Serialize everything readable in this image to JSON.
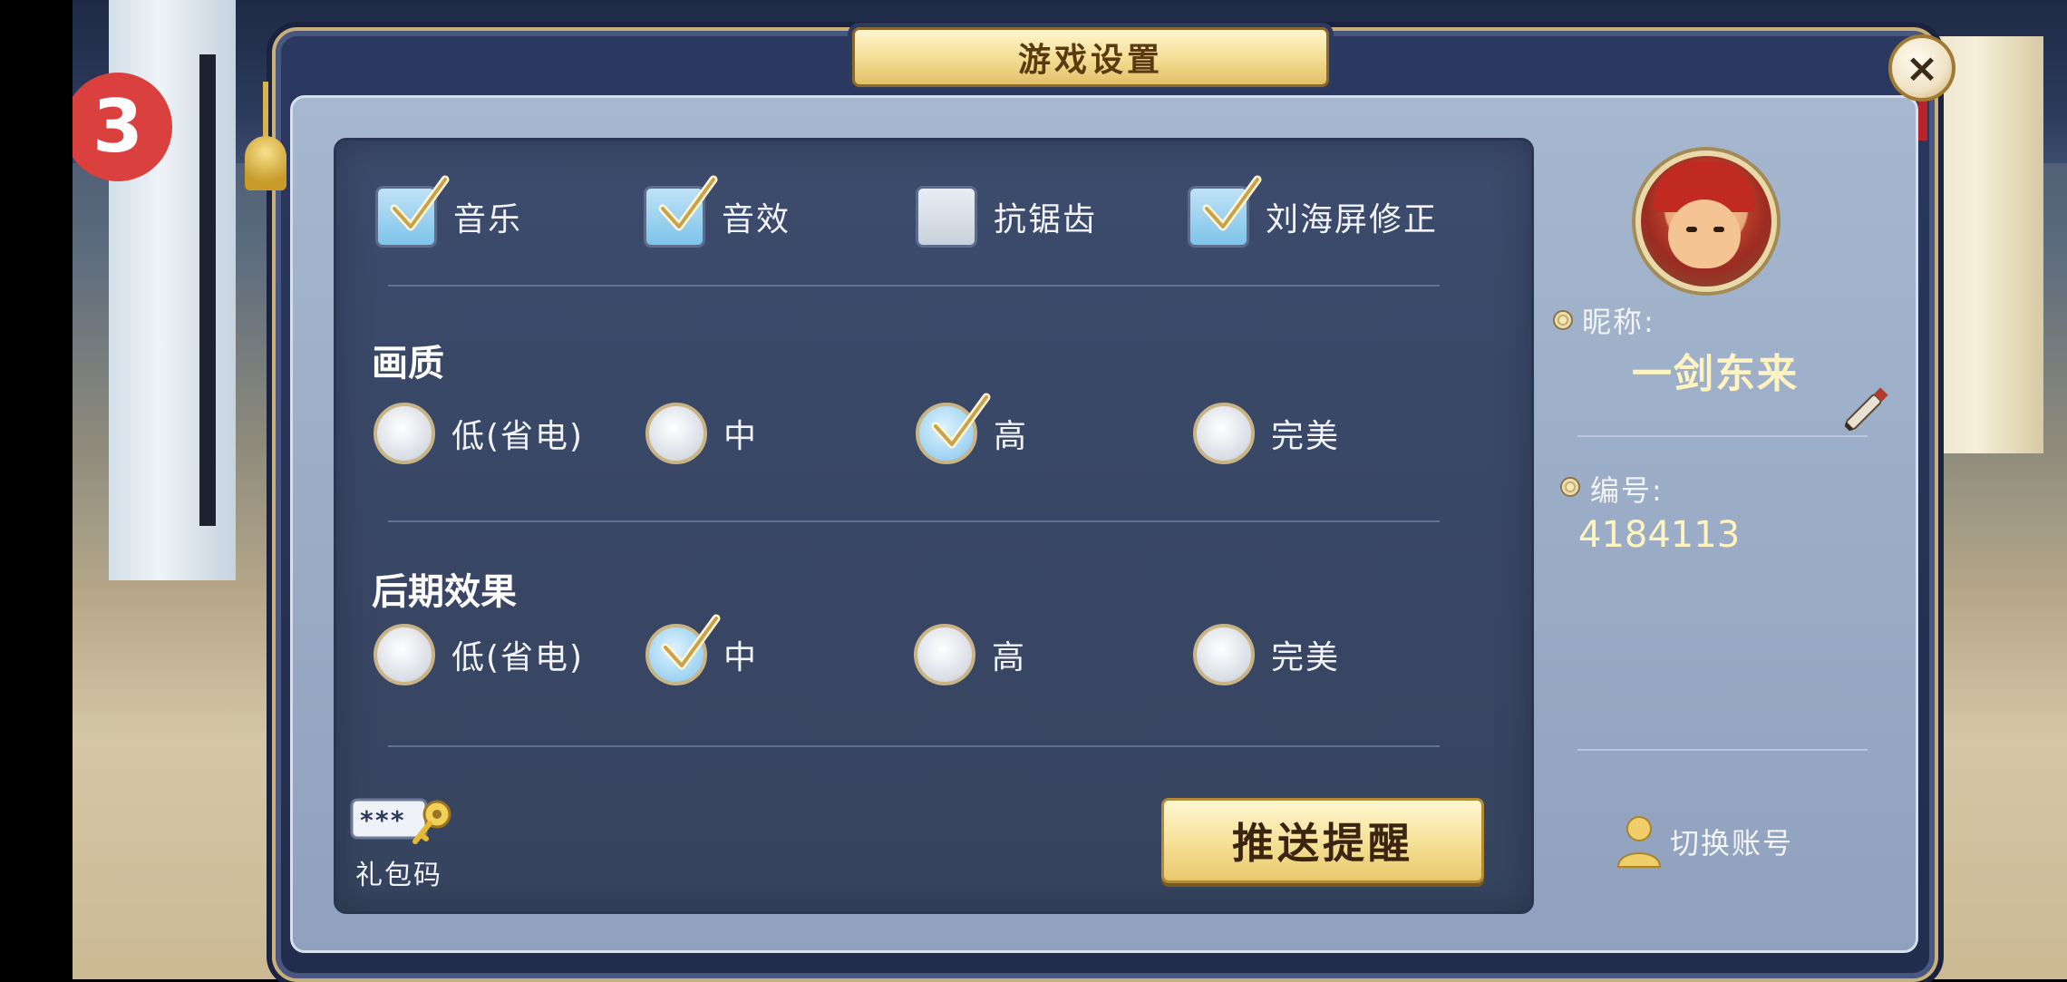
{
  "dialog": {
    "title": "游戏设置",
    "close_label": "×"
  },
  "scene": {
    "badge_text": "3"
  },
  "toggles": [
    {
      "label": "音乐",
      "checked": true
    },
    {
      "label": "音效",
      "checked": true
    },
    {
      "label": "抗锯齿",
      "checked": false
    },
    {
      "label": "刘海屏修正",
      "checked": true
    }
  ],
  "quality": {
    "title": "画质",
    "options": [
      "低(省电)",
      "中",
      "高",
      "完美"
    ],
    "selected": "高"
  },
  "post_effects": {
    "title": "后期效果",
    "options": [
      "低(省电)",
      "中",
      "高",
      "完美"
    ],
    "selected": "中"
  },
  "gift_code": {
    "icon_text": "***",
    "label": "礼包码"
  },
  "push_button": {
    "label": "推送提醒"
  },
  "profile": {
    "nickname_label": "昵称:",
    "nickname": "一剑东来",
    "id_label": "编号:",
    "id": "4184113",
    "switch_account_label": "切换账号"
  },
  "colors": {
    "panel_bg": "#3c4a6c",
    "accent_gold": "#f4dc92",
    "checked_blue": "#7ec4ea",
    "name_color": "#fff4bf"
  }
}
